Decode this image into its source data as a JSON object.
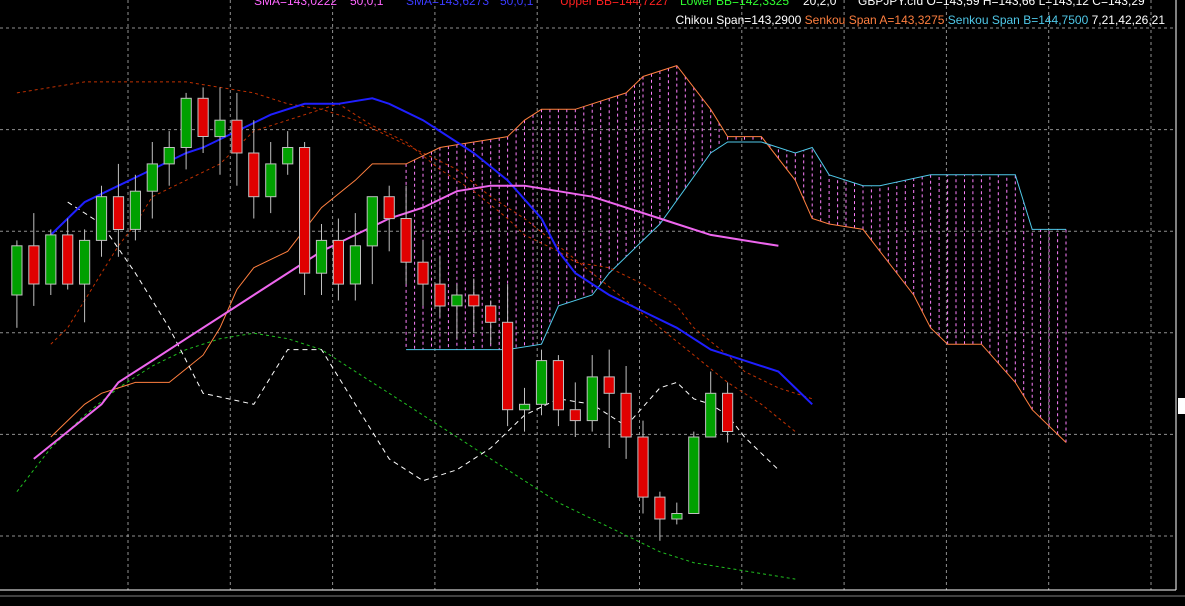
{
  "chart_data": {
    "type": "candlestick",
    "ichimoku": {
      "chikou": [
        [
          -8.0,
          144.7
        ],
        [
          -6.0,
          144.5
        ],
        [
          -4.0,
          144.05
        ],
        [
          -2.0,
          143.55
        ],
        [
          0.0,
          142.95
        ],
        [
          3.0,
          142.85
        ],
        [
          5.0,
          143.35
        ],
        [
          7.0,
          143.35
        ],
        [
          9.0,
          142.85
        ],
        [
          11.0,
          142.35
        ],
        [
          13.0,
          142.15
        ],
        [
          15.0,
          142.25
        ],
        [
          17.0,
          142.45
        ],
        [
          19.0,
          142.75
        ],
        [
          21.0,
          142.9
        ],
        [
          23.0,
          142.85
        ],
        [
          25.0,
          142.65
        ],
        [
          27.0,
          143.0
        ],
        [
          28.0,
          143.05
        ],
        [
          29.0,
          142.9
        ],
        [
          30.0,
          142.85
        ],
        [
          31.0,
          142.75
        ],
        [
          32.0,
          142.55
        ],
        [
          34.0,
          142.25
        ]
      ],
      "kijun": [],
      "senkou_a": [
        [
          -9.0,
          142.55
        ],
        [
          -8.0,
          142.7
        ],
        [
          -7.0,
          142.85
        ],
        [
          -6.0,
          142.95
        ],
        [
          -5.0,
          143.0
        ],
        [
          -4.0,
          143.05
        ],
        [
          -3.0,
          143.05
        ],
        [
          -2.0,
          143.05
        ],
        [
          0.0,
          143.3
        ],
        [
          1.0,
          143.55
        ],
        [
          2.0,
          143.9
        ],
        [
          3.0,
          144.1
        ],
        [
          5.0,
          144.25
        ],
        [
          7.0,
          144.65
        ],
        [
          9.0,
          144.9
        ],
        [
          10.0,
          145.05
        ],
        [
          12.0,
          145.05
        ],
        [
          14.0,
          145.2
        ],
        [
          16.0,
          145.25
        ],
        [
          18.0,
          145.3
        ],
        [
          19.0,
          145.45
        ],
        [
          20.0,
          145.55
        ],
        [
          22.0,
          145.55
        ],
        [
          25.0,
          145.7
        ],
        [
          26.0,
          145.85
        ],
        [
          28.0,
          145.95
        ],
        [
          30.0,
          145.55
        ],
        [
          31.0,
          145.3
        ],
        [
          33.0,
          145.3
        ],
        [
          35.0,
          144.9
        ],
        [
          36.0,
          144.55
        ],
        [
          37.0,
          144.5
        ],
        [
          39.0,
          144.45
        ],
        [
          42.0,
          143.85
        ],
        [
          43.0,
          143.55
        ],
        [
          44.0,
          143.4
        ],
        [
          46.0,
          143.4
        ],
        [
          48.0,
          143.05
        ],
        [
          49.0,
          142.8
        ],
        [
          51.0,
          142.5
        ]
      ],
      "senkou_b": [
        [
          12.0,
          143.35
        ],
        [
          18.0,
          143.35
        ],
        [
          20.0,
          143.4
        ],
        [
          21.0,
          143.75
        ],
        [
          23.0,
          143.85
        ],
        [
          24.0,
          144.05
        ],
        [
          27.0,
          144.5
        ],
        [
          30.0,
          145.15
        ],
        [
          31.0,
          145.25
        ],
        [
          33.0,
          145.25
        ],
        [
          35.0,
          145.15
        ],
        [
          36.0,
          145.2
        ],
        [
          37.0,
          144.95
        ],
        [
          39.0,
          144.85
        ],
        [
          40.0,
          144.85
        ],
        [
          43.0,
          144.95
        ],
        [
          48.0,
          144.95
        ],
        [
          49.0,
          144.45
        ],
        [
          51.0,
          144.45
        ]
      ],
      "tenkan": [
        [
          -9.0,
          143.4
        ],
        [
          -8.0,
          143.55
        ],
        [
          -7.0,
          143.8
        ],
        [
          -6.0,
          144.05
        ],
        [
          -5.0,
          144.3
        ],
        [
          -4.0,
          144.5
        ],
        [
          -3.0,
          144.75
        ],
        [
          -1.0,
          144.9
        ],
        [
          1.0,
          145.05
        ],
        [
          3.0,
          145.35
        ],
        [
          5.0,
          145.45
        ],
        [
          6.0,
          145.5
        ],
        [
          8.0,
          145.6
        ],
        [
          10.0,
          145.4
        ],
        [
          12.0,
          145.25
        ],
        [
          14.0,
          145.0
        ],
        [
          16.0,
          144.8
        ],
        [
          18.0,
          144.55
        ],
        [
          19.0,
          144.4
        ],
        [
          21.0,
          144.25
        ],
        [
          22.0,
          144.15
        ],
        [
          24.0,
          144.1
        ],
        [
          26.0,
          143.95
        ],
        [
          28.0,
          143.75
        ],
        [
          29.0,
          143.55
        ],
        [
          31.0,
          143.3
        ],
        [
          32.0,
          143.15
        ],
        [
          34.0,
          143.0
        ],
        [
          35.0,
          142.95
        ],
        [
          36.0,
          142.9
        ]
      ]
    },
    "legend": [
      {
        "name": "Chikou Span=143,2900",
        "color": "#ffffff"
      },
      {
        "name": "Senkou Span A=143,3275",
        "color": "#ff7f3f"
      },
      {
        "name": "Senkou Span B=144,7500",
        "color": "#4fc8e8"
      }
    ],
    "legend_params": "7,21,42,26,21",
    "sma": [
      {
        "color": "#1f1fff",
        "points": [
          [
            -9.0,
            144.4
          ],
          [
            -7.0,
            144.7
          ],
          [
            -5.0,
            144.85
          ],
          [
            -3.0,
            145.0
          ],
          [
            -1.0,
            145.15
          ],
          [
            0.0,
            145.2
          ],
          [
            2.0,
            145.35
          ],
          [
            4.0,
            145.5
          ],
          [
            6.0,
            145.6
          ],
          [
            8.0,
            145.6
          ],
          [
            10.0,
            145.65
          ],
          [
            11.0,
            145.6
          ],
          [
            13.0,
            145.45
          ],
          [
            14.0,
            145.35
          ],
          [
            16.0,
            145.15
          ],
          [
            18.0,
            144.9
          ],
          [
            20.0,
            144.55
          ],
          [
            21.0,
            144.25
          ],
          [
            22.0,
            144.05
          ],
          [
            24.0,
            143.85
          ],
          [
            26.0,
            143.7
          ],
          [
            28.0,
            143.55
          ],
          [
            30.0,
            143.35
          ],
          [
            32.0,
            143.25
          ],
          [
            34.0,
            143.15
          ],
          [
            35.0,
            143.0
          ],
          [
            36.0,
            142.85
          ]
        ]
      },
      {
        "color": "#ee66ee",
        "points": [
          [
            -10.0,
            142.35
          ],
          [
            -8.0,
            142.6
          ],
          [
            -6.0,
            142.85
          ],
          [
            -5.0,
            143.05
          ],
          [
            -3.0,
            143.25
          ],
          [
            -1.0,
            143.45
          ],
          [
            1.0,
            143.65
          ],
          [
            3.0,
            143.85
          ],
          [
            5.0,
            144.05
          ],
          [
            7.0,
            144.25
          ],
          [
            9.0,
            144.4
          ],
          [
            11.0,
            144.55
          ],
          [
            13.0,
            144.65
          ],
          [
            15.0,
            144.8
          ],
          [
            17.0,
            144.85
          ],
          [
            19.0,
            144.85
          ],
          [
            21.0,
            144.8
          ],
          [
            23.0,
            144.75
          ],
          [
            25.0,
            144.65
          ],
          [
            27.0,
            144.55
          ],
          [
            28.0,
            144.5
          ],
          [
            30.0,
            144.4
          ],
          [
            32.0,
            144.35
          ],
          [
            34.0,
            144.3
          ]
        ]
      }
    ],
    "bollinger": {
      "upper": [
        [
          -11.0,
          145.7
        ],
        [
          -9.0,
          145.75
        ],
        [
          -7.0,
          145.8
        ],
        [
          -5.0,
          145.8
        ],
        [
          -3.0,
          145.8
        ],
        [
          -1.0,
          145.8
        ],
        [
          1.0,
          145.75
        ],
        [
          3.0,
          145.7
        ],
        [
          5.0,
          145.6
        ],
        [
          7.0,
          145.55
        ],
        [
          9.0,
          145.45
        ],
        [
          11.0,
          145.3
        ],
        [
          13.0,
          145.15
        ],
        [
          15.0,
          145.0
        ],
        [
          17.0,
          144.75
        ],
        [
          19.0,
          144.55
        ],
        [
          21.0,
          144.3
        ],
        [
          23.0,
          144.05
        ],
        [
          25.0,
          143.8
        ],
        [
          27.0,
          143.55
        ],
        [
          29.0,
          143.3
        ],
        [
          31.0,
          143.05
        ],
        [
          33.0,
          142.85
        ],
        [
          35.0,
          142.6
        ]
      ],
      "lower": [
        [
          -11.0,
          142.05
        ],
        [
          -9.0,
          142.45
        ],
        [
          -7.0,
          142.75
        ],
        [
          -5.0,
          143.0
        ],
        [
          -3.0,
          143.2
        ],
        [
          -1.0,
          143.35
        ],
        [
          1.0,
          143.45
        ],
        [
          3.0,
          143.5
        ],
        [
          5.0,
          143.45
        ],
        [
          7.0,
          143.35
        ],
        [
          9.0,
          143.15
        ],
        [
          11.0,
          142.95
        ],
        [
          13.0,
          142.75
        ],
        [
          15.0,
          142.55
        ],
        [
          17.0,
          142.35
        ],
        [
          19.0,
          142.15
        ],
        [
          21.0,
          141.95
        ],
        [
          23.0,
          141.8
        ],
        [
          25.0,
          141.65
        ],
        [
          27.0,
          141.5
        ],
        [
          29.0,
          141.4
        ],
        [
          31.0,
          141.35
        ],
        [
          33.0,
          141.3
        ],
        [
          35.0,
          141.25
        ]
      ]
    },
    "candles": [
      [
        -11.0,
        143.85,
        144.35,
        143.55,
        144.3
      ],
      [
        -10.0,
        144.3,
        144.6,
        143.75,
        143.95
      ],
      [
        -9.0,
        143.95,
        144.45,
        143.85,
        144.4
      ],
      [
        -8.0,
        144.4,
        144.55,
        143.9,
        143.95
      ],
      [
        -7.0,
        143.95,
        144.45,
        143.6,
        144.35
      ],
      [
        -6.0,
        144.35,
        144.85,
        144.2,
        144.75
      ],
      [
        -5.0,
        144.75,
        145.05,
        144.2,
        144.45
      ],
      [
        -4.0,
        144.45,
        144.95,
        144.35,
        144.8
      ],
      [
        -3.0,
        144.8,
        145.25,
        144.55,
        145.05
      ],
      [
        -2.0,
        145.05,
        145.35,
        144.85,
        145.2
      ],
      [
        -1.0,
        145.2,
        145.7,
        145.0,
        145.65
      ],
      [
        0.0,
        145.65,
        145.75,
        145.15,
        145.3
      ],
      [
        1.0,
        145.3,
        145.75,
        144.95,
        145.45
      ],
      [
        2.0,
        145.45,
        145.7,
        144.85,
        145.15
      ],
      [
        3.0,
        145.15,
        145.45,
        144.55,
        144.75
      ],
      [
        4.0,
        144.75,
        145.25,
        144.6,
        145.05
      ],
      [
        5.0,
        145.05,
        145.35,
        144.95,
        145.2
      ],
      [
        6.0,
        145.2,
        145.25,
        143.85,
        144.05
      ],
      [
        7.0,
        144.05,
        144.5,
        143.85,
        144.35
      ],
      [
        8.0,
        144.35,
        144.55,
        143.8,
        143.95
      ],
      [
        9.0,
        143.95,
        144.6,
        143.8,
        144.3
      ],
      [
        10.0,
        144.3,
        144.75,
        143.95,
        144.75
      ],
      [
        11.0,
        144.75,
        144.85,
        144.25,
        144.55
      ],
      [
        12.0,
        144.55,
        144.85,
        143.95,
        144.15
      ],
      [
        13.0,
        144.15,
        144.35,
        143.75,
        143.95
      ],
      [
        14.0,
        143.95,
        144.2,
        143.65,
        143.75
      ],
      [
        15.0,
        143.75,
        143.95,
        143.45,
        143.85
      ],
      [
        16.0,
        143.85,
        144.0,
        143.5,
        143.75
      ],
      [
        17.0,
        143.75,
        143.8,
        143.4,
        143.6
      ],
      [
        18.0,
        143.6,
        143.95,
        142.65,
        142.8
      ],
      [
        19.0,
        142.8,
        143.0,
        142.6,
        142.85
      ],
      [
        20.0,
        142.85,
        143.35,
        142.75,
        143.25
      ],
      [
        21.0,
        143.25,
        143.3,
        142.65,
        142.8
      ],
      [
        22.0,
        142.8,
        143.05,
        142.55,
        142.7
      ],
      [
        23.0,
        142.7,
        143.3,
        142.6,
        143.1
      ],
      [
        24.0,
        143.1,
        143.35,
        142.45,
        142.95
      ],
      [
        25.0,
        142.95,
        143.2,
        142.35,
        142.55
      ],
      [
        26.0,
        142.55,
        142.7,
        141.85,
        142.0
      ],
      [
        27.0,
        142.0,
        142.05,
        141.6,
        141.8
      ],
      [
        28.0,
        141.8,
        141.95,
        141.75,
        141.85
      ],
      [
        29.0,
        141.85,
        142.6,
        142.3,
        142.55
      ],
      [
        30.0,
        142.55,
        143.15,
        142.55,
        142.95
      ],
      [
        31.0,
        142.95,
        143.05,
        142.5,
        142.6
      ]
    ],
    "x_range": [
      -12.0,
      57.5
    ],
    "ylim": [
      141.15,
      146.55
    ]
  },
  "header": {
    "sma1_text": "SMA=143,0222",
    "sma1_params": "50,0,1",
    "sma2_text": "SMA=143,6273",
    "sma2_params": "50,0,1",
    "upper_bb_text": "Upper BB=144,7227",
    "lower_bb_text": "Lower BB=142,3325",
    "bb_params": "20,2,0",
    "ohlc_text": "GBPJPY.cfd O=143,59 H=143,66 L=143,12 C=143,29"
  },
  "colors": {
    "background": "#000000",
    "grid": "#c0c0c0",
    "axis": "#ffffff",
    "bull": "#00a000",
    "bear": "#e00000",
    "doji": "#c0c0c0",
    "cloud_hatch": "#ff80ff",
    "chikou": "#ffffff",
    "senkou_a": "#ff7f3f",
    "senkou_b": "#4fc8e8",
    "tenkan": "#c03000",
    "upper_bb": "#c03000",
    "lower_bb": "#20c020",
    "sma_fast": "#1f1fff",
    "sma_slow": "#ee66ee",
    "header_sma1": "#ff66ff",
    "header_sma2": "#3b3bff",
    "header_upper_bb": "#ff2020",
    "header_lower_bb": "#30ff30",
    "header_text": "#ffffff"
  }
}
